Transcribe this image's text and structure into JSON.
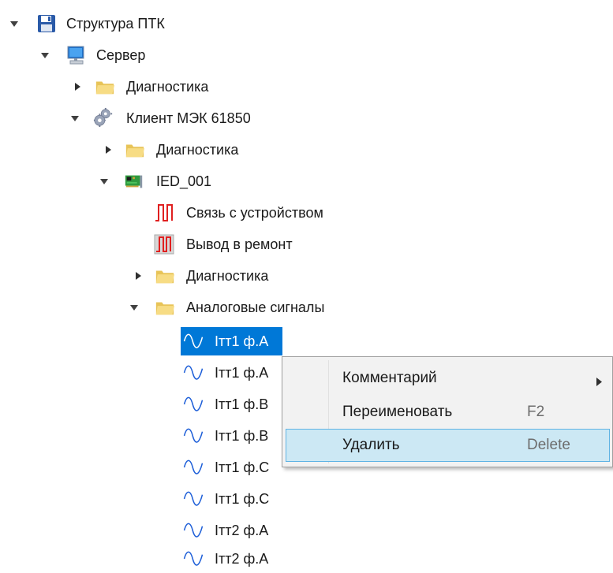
{
  "tree": {
    "root": {
      "label": "Структура ПТК",
      "icon": "floppy-disk-icon"
    },
    "server": {
      "label": "Сервер",
      "icon": "monitor-icon"
    },
    "server_diag": {
      "label": "Диагностика",
      "icon": "folder-icon"
    },
    "client": {
      "label": "Клиент МЭК 61850",
      "icon": "gears-icon"
    },
    "client_diag": {
      "label": "Диагностика",
      "icon": "folder-icon"
    },
    "ied": {
      "label": "IED_001",
      "icon": "circuit-board-icon"
    },
    "ied_link": {
      "label": "Связь с устройством",
      "icon": "pulse-signal-icon"
    },
    "ied_repair": {
      "label": "Вывод в ремонт",
      "icon": "pulse-signal-boxed-icon"
    },
    "ied_diag": {
      "label": "Диагностика",
      "icon": "folder-icon"
    },
    "analog": {
      "label": "Аналоговые сигналы",
      "icon": "folder-icon"
    },
    "signals": [
      {
        "label": "Iтт1 ф.А",
        "icon": "sine-wave-icon",
        "selected": true
      },
      {
        "label": "Iтт1 ф.А",
        "icon": "sine-wave-icon"
      },
      {
        "label": "Iтт1 ф.В",
        "icon": "sine-wave-icon"
      },
      {
        "label": "Iтт1 ф.В",
        "icon": "sine-wave-icon"
      },
      {
        "label": "Iтт1 ф.С",
        "icon": "sine-wave-icon"
      },
      {
        "label": "Iтт1 ф.С",
        "icon": "sine-wave-icon"
      },
      {
        "label": "Iтт2 ф.А",
        "icon": "sine-wave-icon"
      },
      {
        "label": "Iтт2 ф.А",
        "icon": "sine-wave-icon"
      }
    ]
  },
  "context_menu": {
    "items": [
      {
        "label": "Комментарий",
        "shortcut": "",
        "has_submenu": true
      },
      {
        "label": "Переименовать",
        "shortcut": "F2"
      },
      {
        "label": "Удалить",
        "shortcut": "Delete",
        "highlighted": true
      }
    ]
  },
  "colors": {
    "selection": "#0078d7",
    "menu_hover_bg": "#cce8f4",
    "menu_hover_border": "#5fb3e4",
    "menu_bg": "#f2f2f2"
  }
}
